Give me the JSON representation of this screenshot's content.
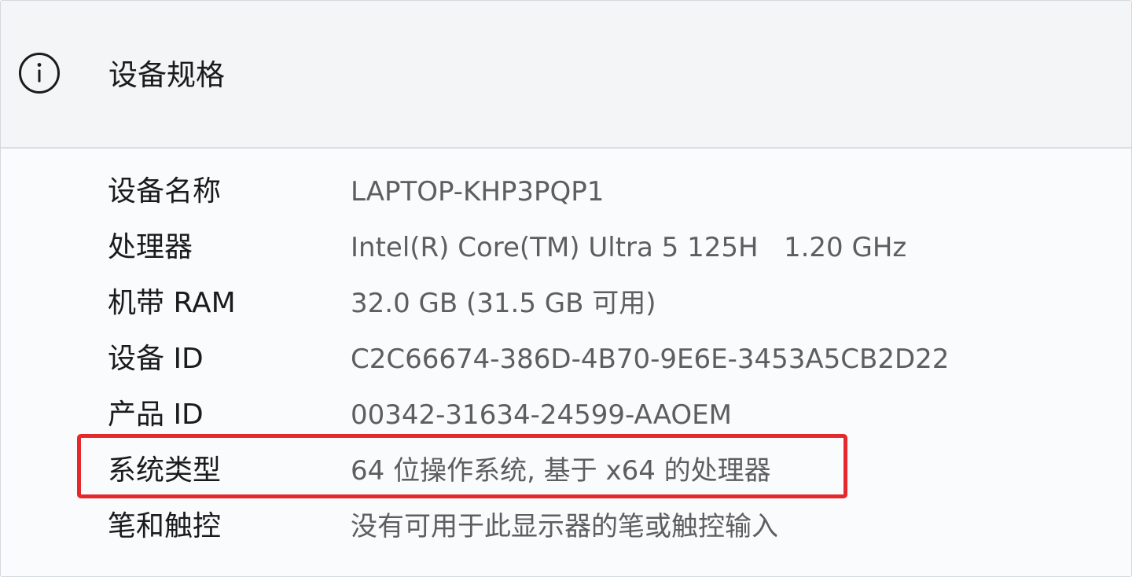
{
  "header": {
    "icon": "info-circle-icon",
    "title": "设备规格"
  },
  "specs": [
    {
      "label": "设备名称",
      "value": "LAPTOP-KHP3PQP1"
    },
    {
      "label": "处理器",
      "value": "Intel(R) Core(TM) Ultra 5 125H   1.20 GHz"
    },
    {
      "label": "机带 RAM",
      "value": "32.0 GB (31.5 GB 可用)"
    },
    {
      "label": "设备 ID",
      "value": "C2C66674-386D-4B70-9E6E-3453A5CB2D22"
    },
    {
      "label": "产品 ID",
      "value": "00342-31634-24599-AAOEM"
    },
    {
      "label": "系统类型",
      "value": "64 位操作系统, 基于 x64 的处理器"
    },
    {
      "label": "笔和触控",
      "value": "没有可用于此显示器的笔或触控输入"
    }
  ],
  "highlight": {
    "row": "系统类型",
    "color": "#e5282c"
  }
}
